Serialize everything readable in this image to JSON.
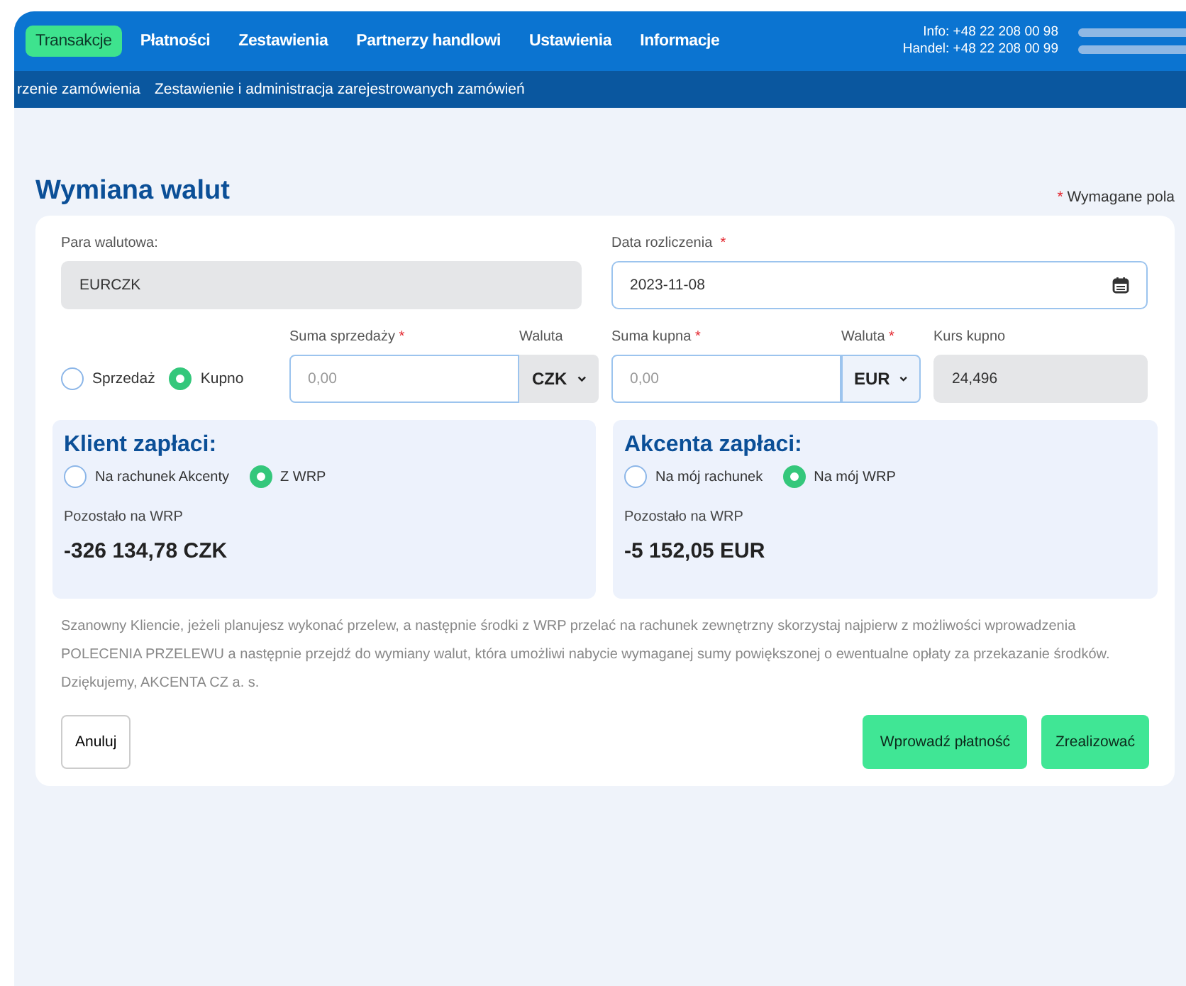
{
  "nav": {
    "tabs": [
      {
        "label": "Transakcje",
        "selected": true
      },
      {
        "label": "Płatności",
        "selected": false
      },
      {
        "label": "Zestawienia",
        "selected": false
      },
      {
        "label": "Partnerzy handlowi",
        "selected": false
      },
      {
        "label": "Ustawienia",
        "selected": false
      },
      {
        "label": "Informacje",
        "selected": false
      }
    ],
    "contact": [
      "Info: +48 22 208 00 98",
      "Handel: +48 22 208 00 99"
    ]
  },
  "subnav": {
    "items": [
      "rzenie zamówienia",
      "Zestawienie i administracja zarejestrowanych zamówień"
    ]
  },
  "title": "Wymiana walut",
  "required_note": {
    "mark": "*",
    "text": "Wymagane pola"
  },
  "pair": {
    "label": "Para walutowa:",
    "value": "EURCZK"
  },
  "date": {
    "label": "Data rozliczenia",
    "required_mark": "*",
    "value": "2023-11-08"
  },
  "direction": [
    {
      "label": "Sprzedaż",
      "selected": false
    },
    {
      "label": "Kupno",
      "selected": true
    }
  ],
  "sell": {
    "amount": {
      "label": "Suma sprzedaży",
      "required_mark": "*",
      "placeholder": "0,00"
    },
    "currency": {
      "label": "Waluta",
      "value": "CZK"
    }
  },
  "buy": {
    "amount": {
      "label": "Suma kupna",
      "required_mark": "*",
      "placeholder": "0,00"
    },
    "currency": {
      "label": "Waluta",
      "required_mark": "*",
      "value": "EUR"
    }
  },
  "rate": {
    "label": "Kurs kupno",
    "value": "24,496"
  },
  "panels": [
    {
      "title": "Klient zapłaci:",
      "options": [
        {
          "label": "Na rachunek Akcenty",
          "selected": false
        },
        {
          "label": "Z WRP",
          "selected": true
        }
      ],
      "balance_label": "Pozostało na WRP",
      "balance": "-326 134,78 CZK"
    },
    {
      "title": "Akcenta zapłaci:",
      "options": [
        {
          "label": "Na mój rachunek",
          "selected": false
        },
        {
          "label": "Na mój WRP",
          "selected": true
        }
      ],
      "balance_label": "Pozostało na WRP",
      "balance": "-5 152,05 EUR"
    }
  ],
  "notice": "Szanowny Kliencie, jeżeli planujesz wykonać przelew, a następnie środki z WRP przelać na rachunek zewnętrzny skorzystaj najpierw z możliwości wprowadzenia POLECENIA PRZELEWU a następnie przejdź do wymiany walut, która umożliwi nabycie wymaganej sumy powiększonej o ewentualne opłaty za przekazanie środków. Dziękujemy, AKCENTA CZ a. s.",
  "buttons": [
    {
      "label": "Anuluj",
      "kind": "secondary"
    },
    {
      "label": "Wprowadź płatność",
      "kind": "primary"
    },
    {
      "label": "Zrealizować",
      "kind": "primary"
    }
  ]
}
